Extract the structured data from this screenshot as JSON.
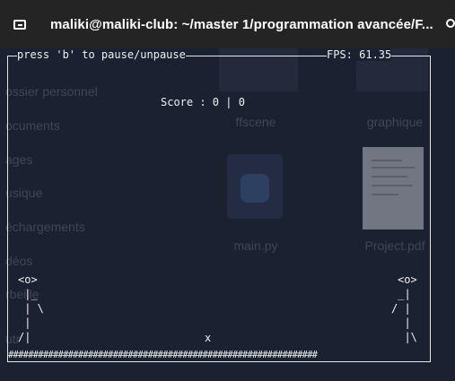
{
  "window": {
    "title": "maliki@maliki-club: ~/master 1/programmation avancée/F..."
  },
  "background_file_manager": {
    "sidebar_items": [
      "ossier personnel",
      "ocuments",
      "ages",
      "usique",
      "échargements",
      "déos",
      "rbeille",
      "utr"
    ],
    "files": [
      "ffscene",
      "graphique",
      "main.py",
      "Project.pdf"
    ]
  },
  "game": {
    "pause_hint": "press 'b' to pause/unpause",
    "fps": "FPS: 61.35",
    "score": "Score : 0 | 0",
    "ball": "x",
    "ground": "##############################################################",
    "left_player": [
      "<o>",
      " |_",
      " | \\",
      " |",
      "/|"
    ],
    "right_player": [
      "<o>",
      " _|",
      "/ |",
      "  |",
      "  |\\"
    ]
  }
}
